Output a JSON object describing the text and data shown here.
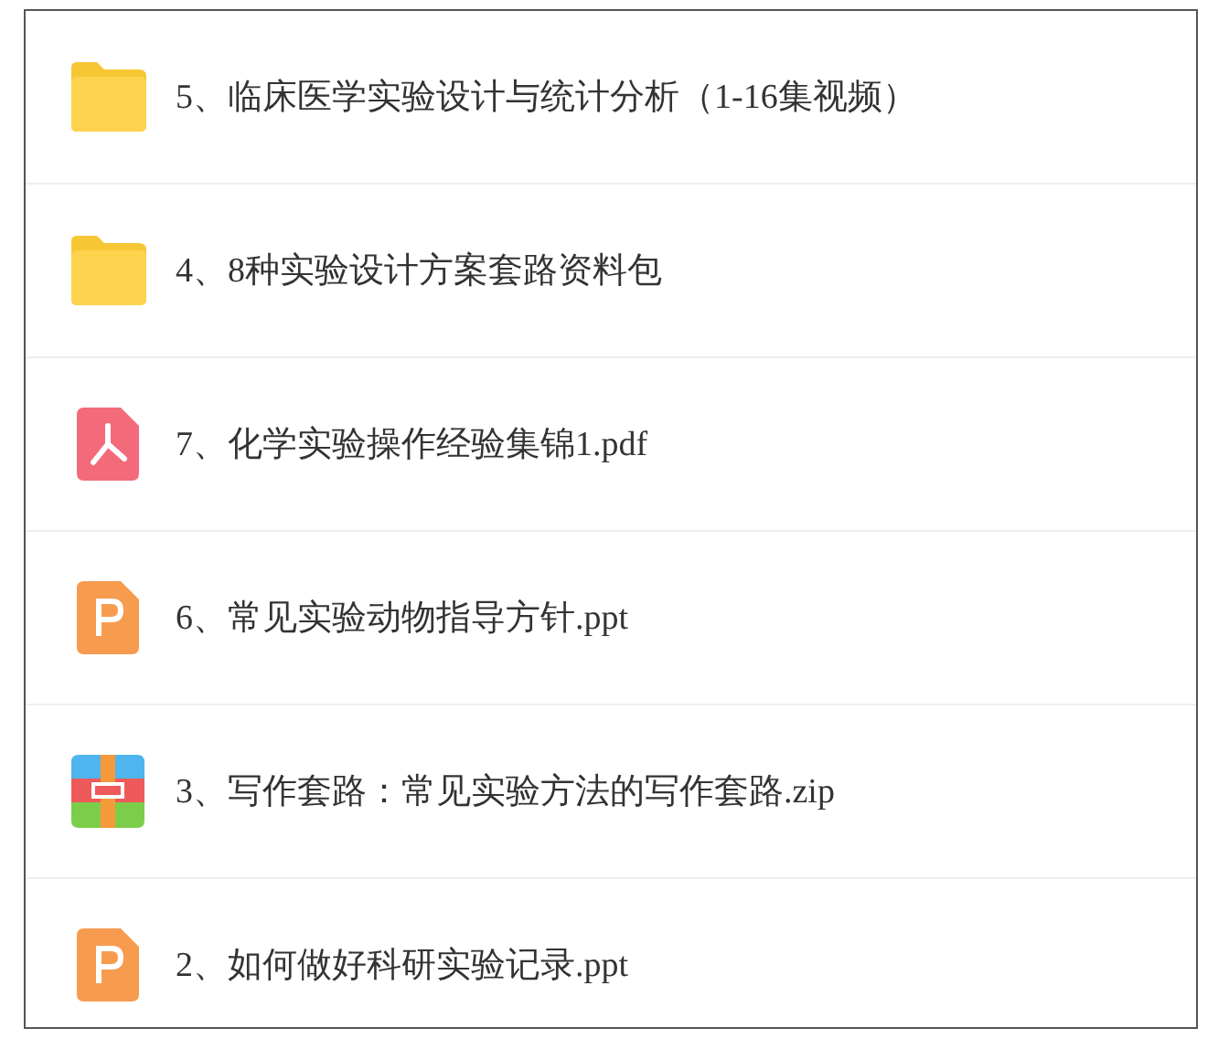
{
  "files": [
    {
      "kind": "folder",
      "name": "5、临床医学实验设计与统计分析（1-16集视频）"
    },
    {
      "kind": "folder",
      "name": "4、8种实验设计方案套路资料包"
    },
    {
      "kind": "pdf",
      "name": "7、化学实验操作经验集锦1.pdf"
    },
    {
      "kind": "ppt",
      "name": "6、常见实验动物指导方针.ppt"
    },
    {
      "kind": "zip",
      "name": "3、写作套路：常见实验方法的写作套路.zip"
    },
    {
      "kind": "ppt",
      "name": "2、如何做好科研实验记录.ppt"
    }
  ]
}
